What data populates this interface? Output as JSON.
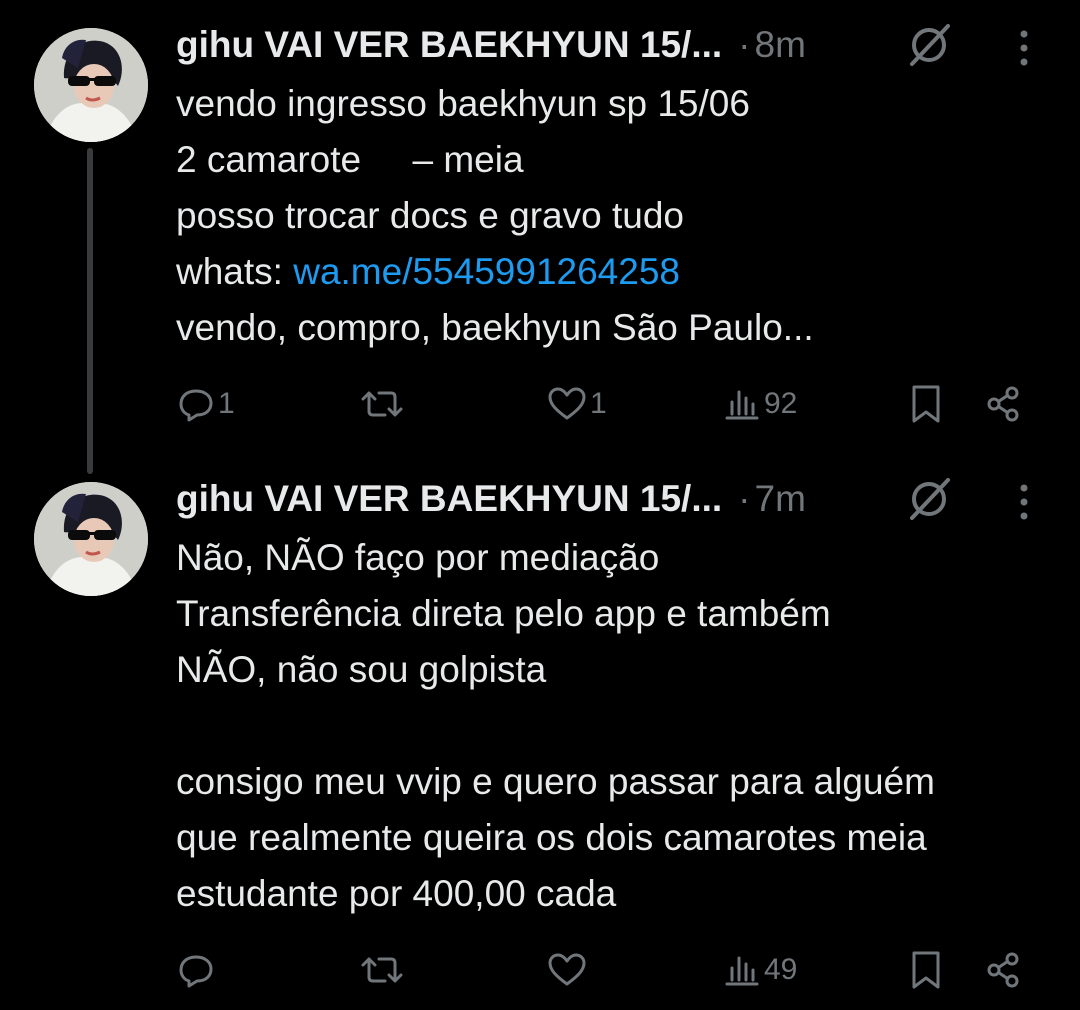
{
  "tweets": [
    {
      "author": "gihu VAI VER BAEKHYUN 15/...",
      "separator": "·",
      "time": "8m",
      "lines": [
        {
          "text": "vendo ingresso baekhyun sp 15/06"
        },
        {
          "text": "2 camarote     – meia"
        },
        {
          "text": "posso trocar docs e gravo tudo"
        },
        {
          "prefix": "whats: ",
          "link": "wa.me/5545991264258"
        },
        {
          "text": "vendo, compro, baekhyun São Paulo..."
        }
      ],
      "stats": {
        "replies": "1",
        "reposts": "",
        "likes": "1",
        "views": "92"
      }
    },
    {
      "author": "gihu VAI VER BAEKHYUN 15/...",
      "separator": "·",
      "time": "7m",
      "lines": [
        {
          "text": "Não, NÃO faço por mediação"
        },
        {
          "text": "Transferência direta pelo app e também"
        },
        {
          "text": "NÃO, não sou golpista"
        },
        {
          "text": ""
        },
        {
          "text": "consigo meu vvip e quero passar para alguém"
        },
        {
          "text": "que realmente queira os dois camarotes meia"
        },
        {
          "text": "estudante por 400,00 cada"
        }
      ],
      "stats": {
        "replies": "",
        "reposts": "",
        "likes": "",
        "views": "49"
      }
    }
  ],
  "icons": {
    "reply": "reply-icon",
    "repost": "repost-icon",
    "like": "heart-icon",
    "views": "views-icon",
    "bookmark": "bookmark-icon",
    "share": "share-icon",
    "grok": "grok-icon",
    "more": "more-icon"
  },
  "colors": {
    "background": "#000000",
    "text": "#e7e9ea",
    "muted": "#71767b",
    "link": "#1d9bf0"
  }
}
